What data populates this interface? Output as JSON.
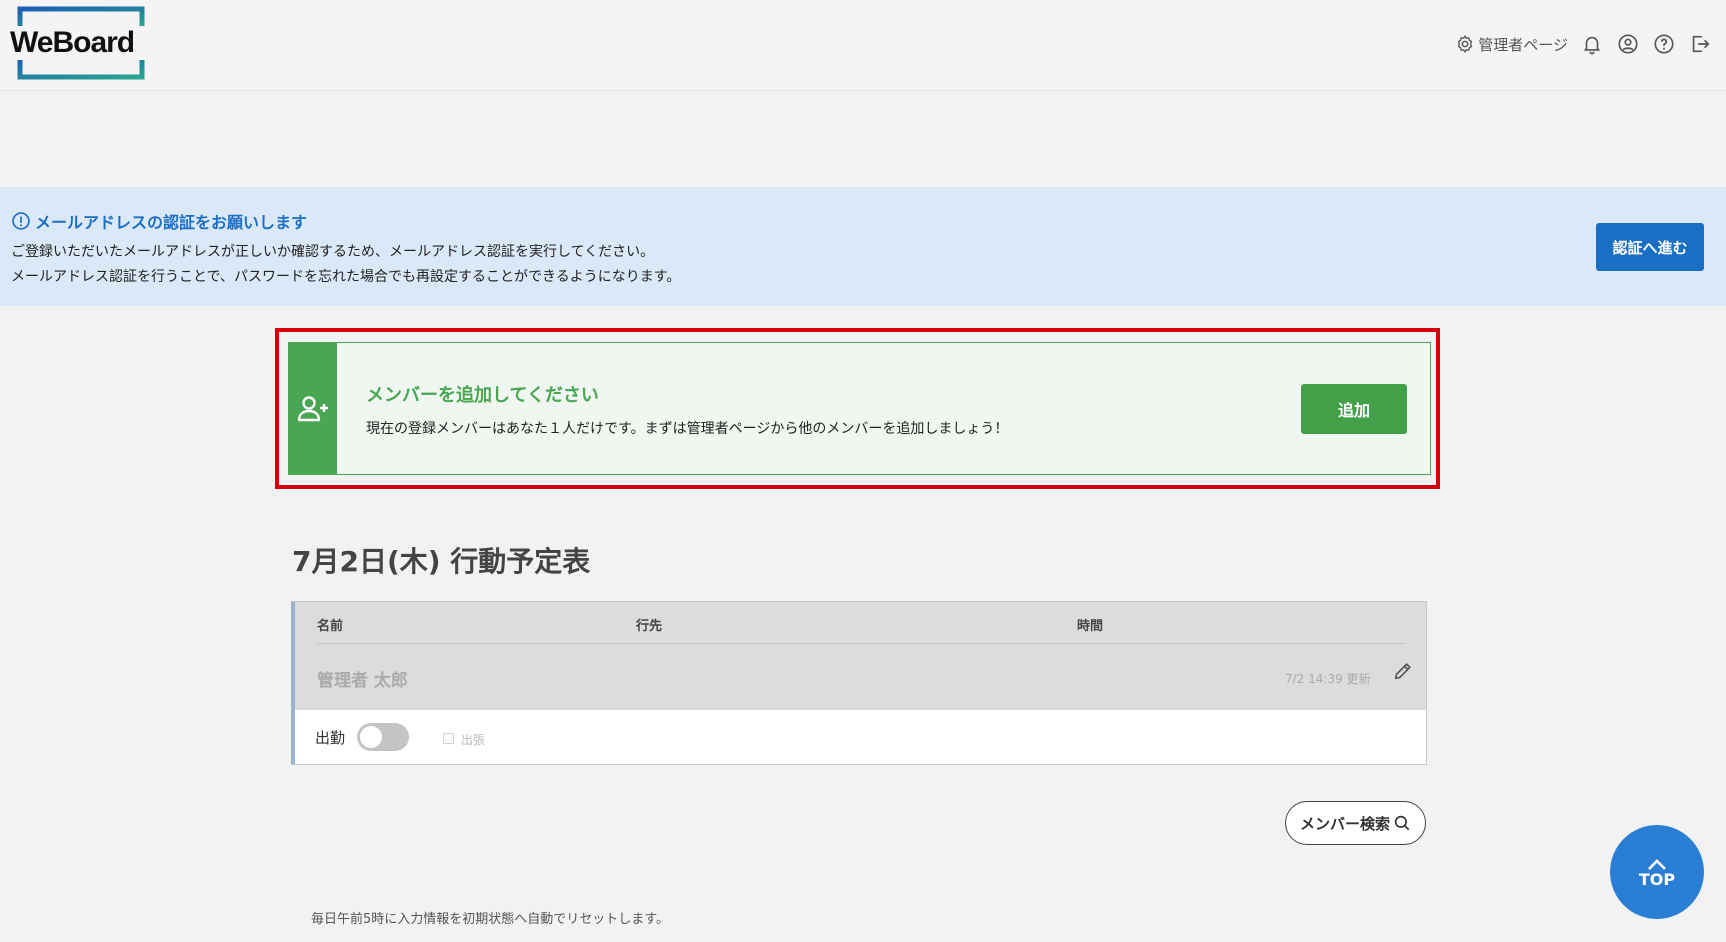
{
  "header": {
    "logo_text": "WeBoard",
    "admin_link": "管理者ページ",
    "icons": [
      "gear-icon",
      "bell-icon",
      "user-circle-icon",
      "help-icon",
      "logout-icon"
    ]
  },
  "email_alert": {
    "title": "メールアドレスの認証をお願いします",
    "line1": "ご登録いただいたメールアドレスが正しいか確認するため、メールアドレス認証を実行してください。",
    "line2": "メールアドレス認証を行うことで、パスワードを忘れた場合でも再設定することができるようになります。",
    "button": "認証へ進む"
  },
  "member_prompt": {
    "title": "メンバーを追加してください",
    "description": "現在の登録メンバーはあなた１人だけです。まずは管理者ページから他のメンバーを追加しましょう！",
    "button": "追加"
  },
  "schedule": {
    "title": "7月2日(木) 行動予定表",
    "columns": [
      "名前",
      "行先",
      "時間"
    ],
    "rows": [
      {
        "name": "管理者 太郎",
        "updated": "7/2 14:39 更新",
        "attendance_label": "出勤",
        "attendance_on": false,
        "trip_label": "出張",
        "trip_checked": false
      }
    ]
  },
  "member_search": "メンバー検索",
  "footer_note": "毎日午前5時に入力情報を初期状態へ自動でリセットします。",
  "top_button": "TOP",
  "colors": {
    "brand_blue": "#1a6fc4",
    "alert_bg": "#dbe8f7",
    "green": "#49a653",
    "highlight_red": "#d7000f"
  }
}
